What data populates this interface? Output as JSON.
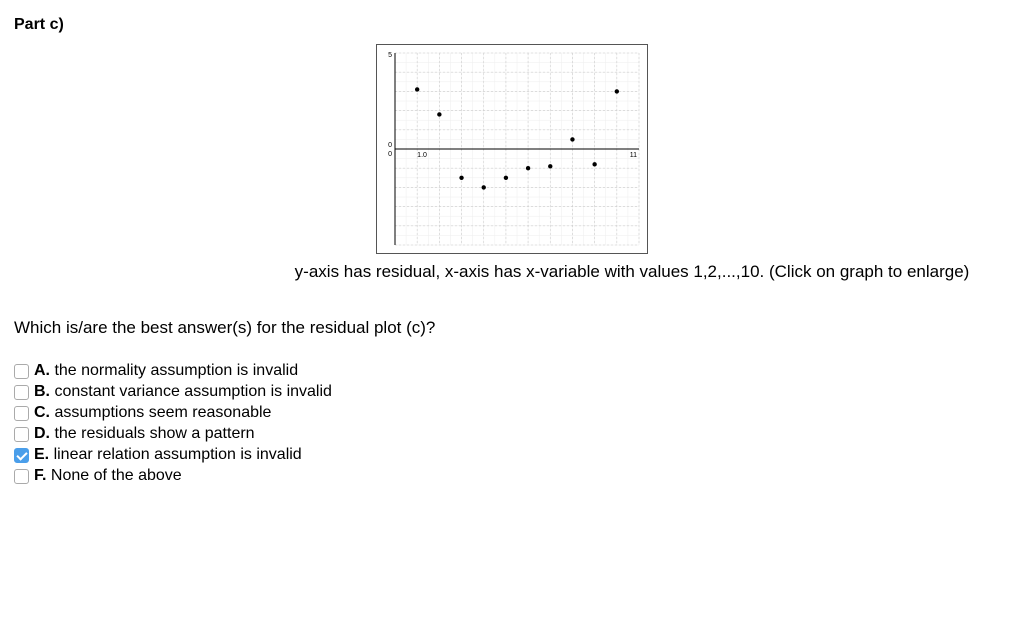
{
  "part_title": "Part c)",
  "caption": "y-axis has residual, x-axis has x-variable with values 1,2,...,10. (Click on graph to enlarge)",
  "question": "Which is/are the best answer(s) for the residual plot (c)?",
  "options": [
    {
      "letter": "A.",
      "text": " the normality assumption is invalid",
      "checked": false
    },
    {
      "letter": "B.",
      "text": " constant variance assumption is invalid",
      "checked": false
    },
    {
      "letter": "C.",
      "text": " assumptions seem reasonable",
      "checked": false
    },
    {
      "letter": "D.",
      "text": " the residuals show a pattern",
      "checked": false
    },
    {
      "letter": "E.",
      "text": " linear relation assumption is invalid",
      "checked": true
    },
    {
      "letter": "F.",
      "text": " None of the above",
      "checked": false
    }
  ],
  "chart_data": {
    "type": "scatter",
    "title": "",
    "xlabel": "x-variable",
    "ylabel": "residual",
    "xlim": [
      0,
      11
    ],
    "ylim": [
      -5,
      5
    ],
    "axis_labels": {
      "y_top": "5",
      "y_zero_pos": "0",
      "y_zero_neg": "0",
      "x_left": "1.0",
      "x_right": "11"
    },
    "points": [
      {
        "x": 1,
        "y": 3.1
      },
      {
        "x": 2,
        "y": 1.8
      },
      {
        "x": 3,
        "y": -1.5
      },
      {
        "x": 4,
        "y": -2.0
      },
      {
        "x": 5,
        "y": -1.5
      },
      {
        "x": 6,
        "y": -1.0
      },
      {
        "x": 7,
        "y": -0.9
      },
      {
        "x": 8,
        "y": 0.5
      },
      {
        "x": 9,
        "y": -0.8
      },
      {
        "x": 10,
        "y": 3.0
      }
    ]
  }
}
